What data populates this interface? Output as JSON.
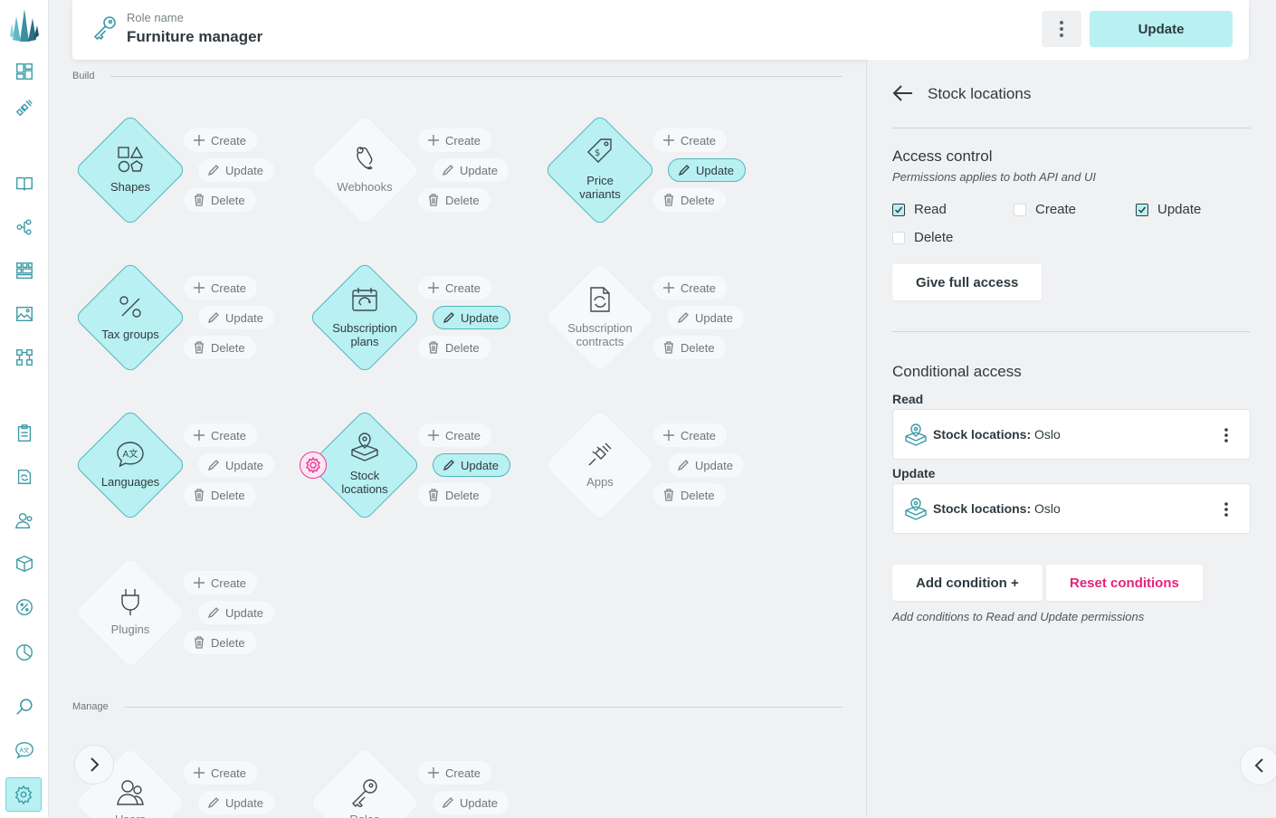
{
  "header": {
    "role_name_label": "Role name",
    "role_name_value": "Furniture manager",
    "update_label": "Update"
  },
  "sections": {
    "build": "Build",
    "manage": "Manage"
  },
  "actions": {
    "create": "Create",
    "update": "Update",
    "delete": "Delete"
  },
  "tiles": [
    {
      "label": "Shapes",
      "icon": "shapes-icon",
      "enabled": true,
      "create": false,
      "update": false,
      "delete": false
    },
    {
      "label": "Webhooks",
      "icon": "webhook-icon",
      "enabled": false,
      "create": false,
      "update": false,
      "delete": false
    },
    {
      "label": "Price variants",
      "icon": "price-tag-icon",
      "enabled": true,
      "create": false,
      "update": true,
      "delete": false
    },
    {
      "label": "Tax groups",
      "icon": "percent-icon",
      "enabled": true,
      "create": false,
      "update": false,
      "delete": false
    },
    {
      "label": "Subscription plans",
      "icon": "calendar-icon",
      "enabled": true,
      "create": false,
      "update": true,
      "delete": false
    },
    {
      "label": "Subscription contracts",
      "icon": "contract-icon",
      "enabled": false,
      "create": false,
      "update": false,
      "delete": false
    },
    {
      "label": "Languages",
      "icon": "translate-icon",
      "enabled": true,
      "create": false,
      "update": false,
      "delete": false
    },
    {
      "label": "Stock locations",
      "icon": "stock-location-icon",
      "enabled": true,
      "create": false,
      "update": true,
      "delete": false,
      "has_conditions": true
    },
    {
      "label": "Apps",
      "icon": "plug-icon",
      "enabled": false,
      "create": false,
      "update": false,
      "delete": false
    },
    {
      "label": "Plugins",
      "icon": "plugin-icon",
      "enabled": false,
      "create": false,
      "update": false,
      "delete": false
    },
    {
      "label": "Users",
      "icon": "users-icon",
      "enabled": false,
      "create": false,
      "update": false,
      "delete": false
    },
    {
      "label": "Roles",
      "icon": "key-icon",
      "enabled": false,
      "create": false,
      "update": false,
      "delete": false
    }
  ],
  "panel": {
    "title": "Stock locations",
    "access_title": "Access control",
    "access_hint": "Permissions applies to both API and UI",
    "permissions": [
      {
        "label": "Read",
        "checked": true
      },
      {
        "label": "Create",
        "checked": false
      },
      {
        "label": "Update",
        "checked": true
      },
      {
        "label": "Delete",
        "checked": false
      }
    ],
    "full_access_label": "Give full access",
    "conditional_title": "Conditional access",
    "conditions": [
      {
        "group": "Read",
        "key": "Stock locations:",
        "value": "Oslo"
      },
      {
        "group": "Update",
        "key": "Stock locations:",
        "value": "Oslo"
      }
    ],
    "add_condition_label": "Add condition +",
    "reset_conditions_label": "Reset conditions",
    "footer_hint": "Add conditions to Read and Update permissions"
  },
  "colors": {
    "accent": "#b9f0f2",
    "accent_border": "#4fb8be",
    "danger": "#e5237a"
  }
}
